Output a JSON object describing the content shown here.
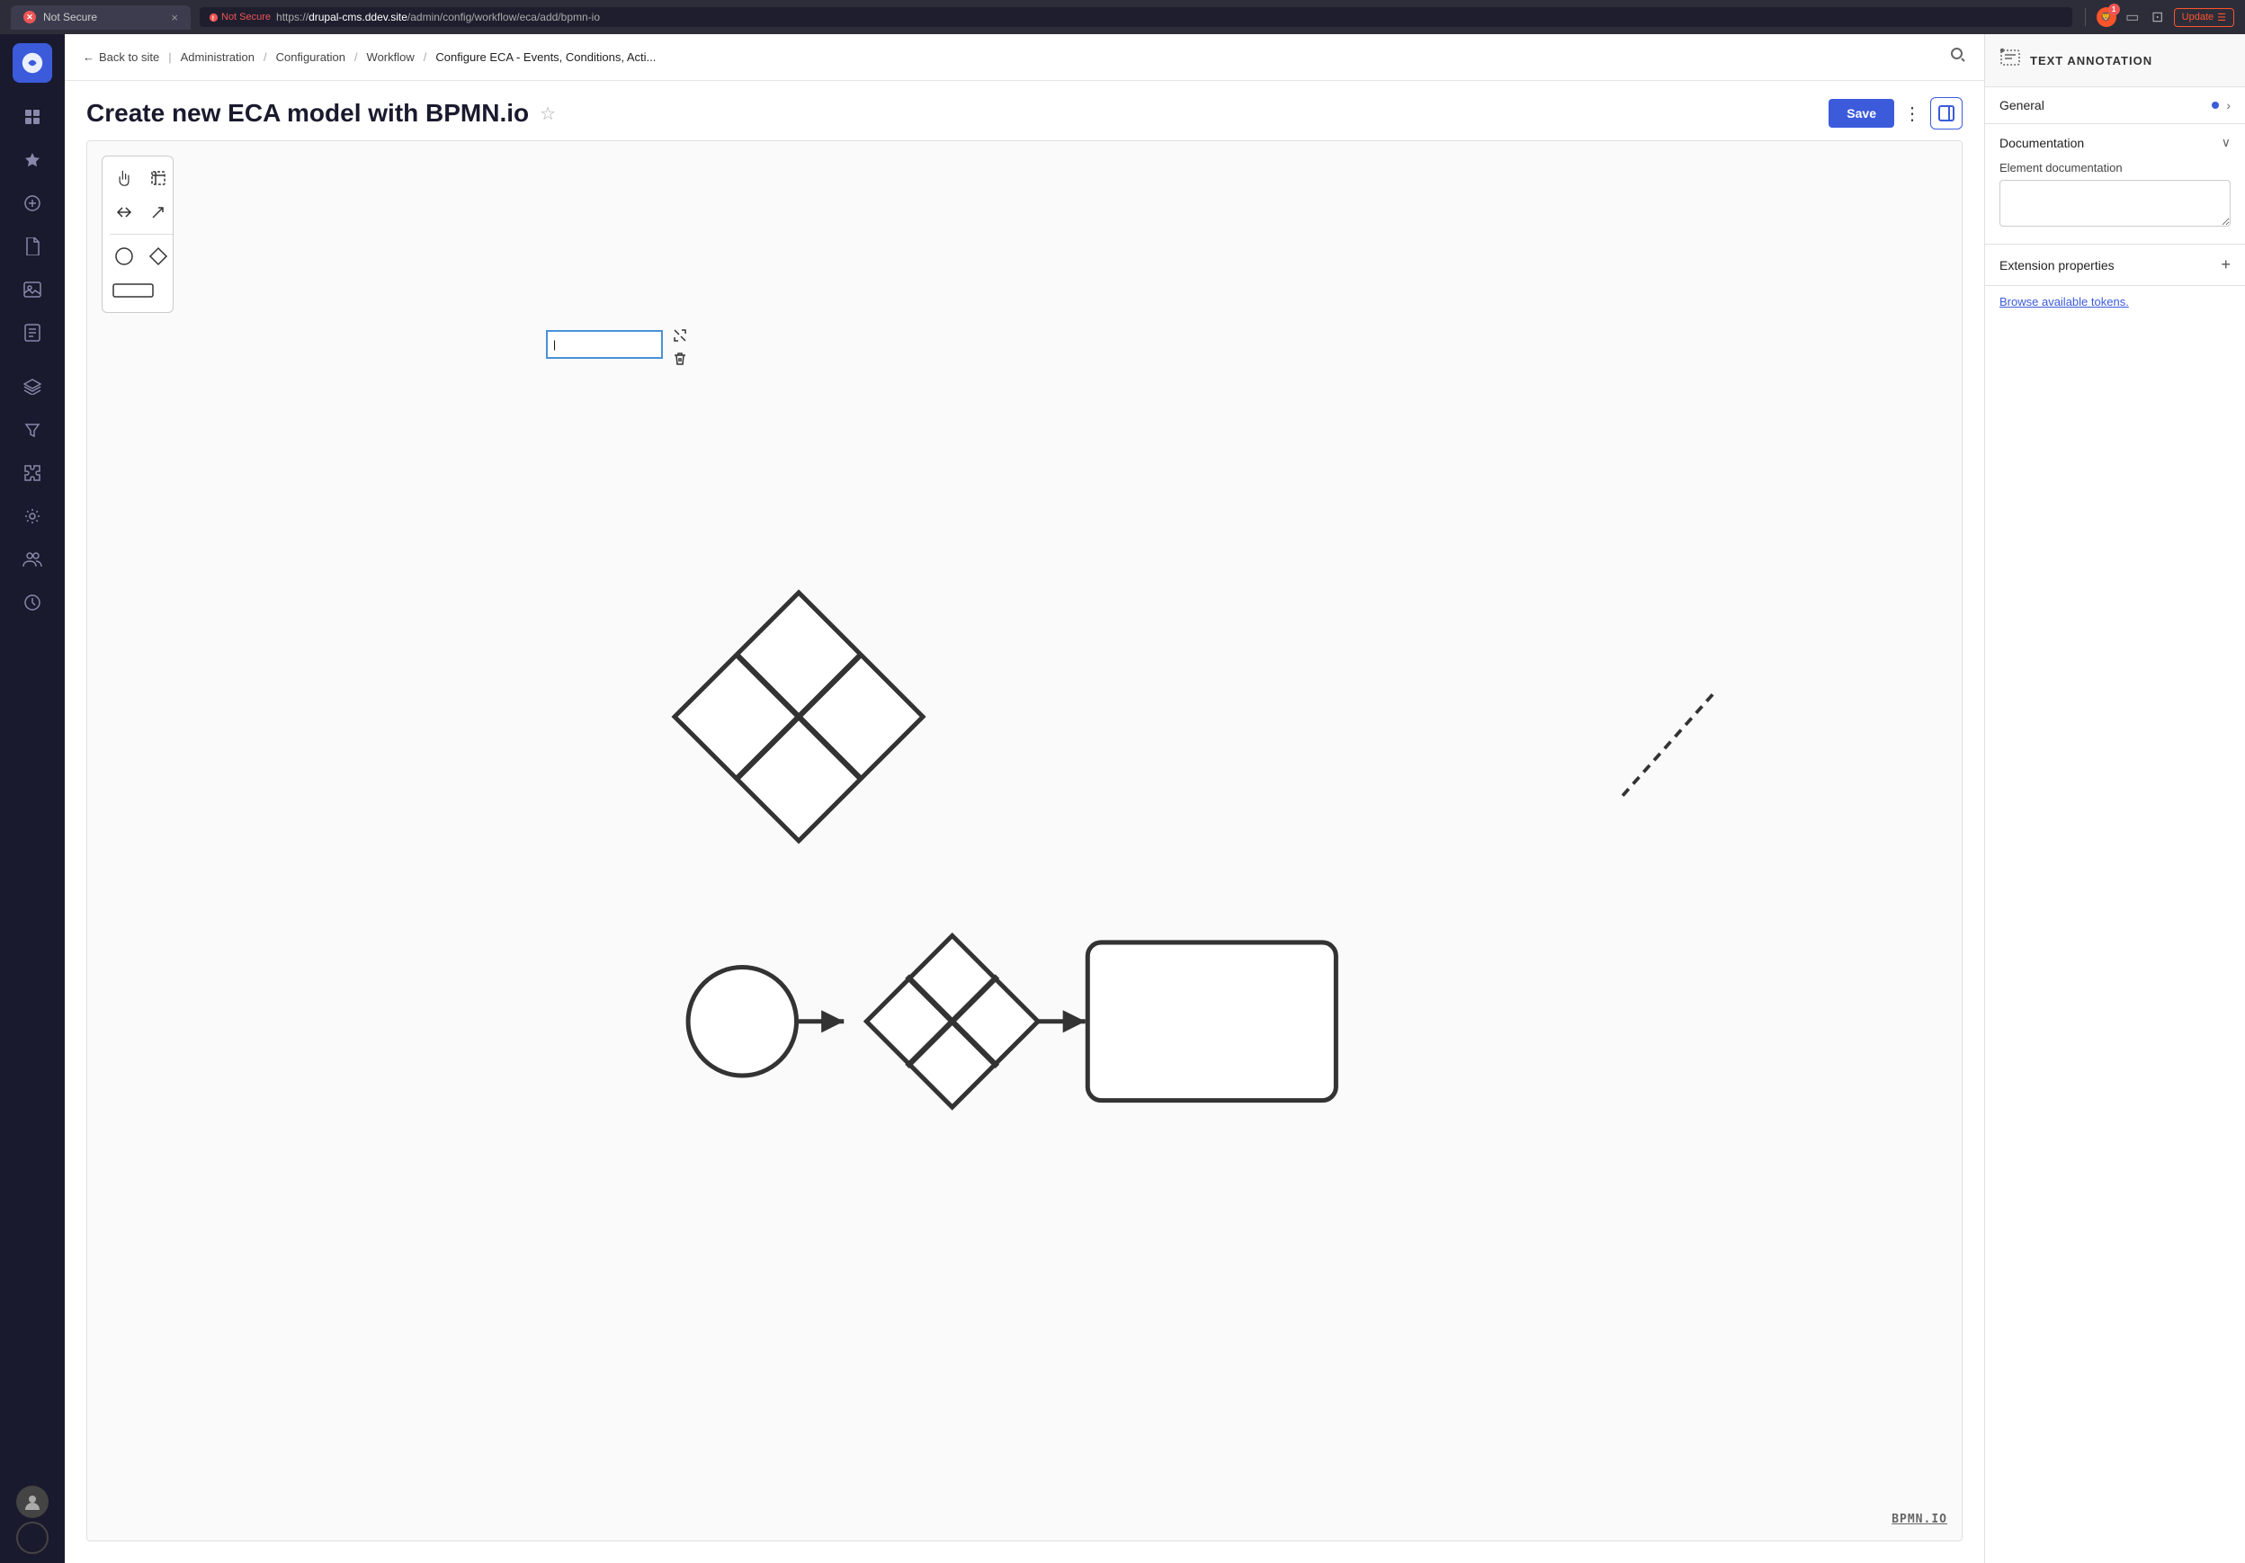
{
  "browser": {
    "tab_title": "Not Secure",
    "tab_favicon_label": "✕",
    "url_prefix": "https://",
    "url_domain": "drupal-cms.ddev.site",
    "url_path": "/admin/config/workflow/eca/add/bpmn-io",
    "brave_badge": "1",
    "update_button": "Update"
  },
  "breadcrumbs": {
    "back_label": "Back to site",
    "items": [
      {
        "label": "Administration"
      },
      {
        "label": "Configuration"
      },
      {
        "label": "Workflow"
      },
      {
        "label": "Configure ECA - Events, Conditions, Acti..."
      }
    ],
    "separator": "/"
  },
  "page": {
    "title": "Create new ECA model with BPMN.io",
    "save_button": "Save",
    "panel_toggle_title": "Toggle panel"
  },
  "right_panel": {
    "header_icon": "···",
    "title": "TEXT ANNOTATION",
    "sections": [
      {
        "label": "General",
        "has_dot": true,
        "has_chevron": true
      }
    ],
    "documentation": {
      "label": "Documentation",
      "element_doc_label": "Element documentation",
      "textarea_placeholder": ""
    },
    "extension": {
      "label": "Extension properties",
      "add_icon": "+"
    },
    "browse_tokens": "Browse available tokens."
  },
  "sidebar": {
    "items": [
      {
        "name": "dashboard",
        "icon": "⊞",
        "active": false
      },
      {
        "name": "starred",
        "icon": "☆",
        "active": false
      },
      {
        "name": "add",
        "icon": "⊕",
        "active": false
      },
      {
        "name": "document",
        "icon": "⊡",
        "active": false
      },
      {
        "name": "media",
        "icon": "⊟",
        "active": false
      },
      {
        "name": "page",
        "icon": "□",
        "active": false
      },
      {
        "name": "layers",
        "icon": "⧉",
        "active": false
      },
      {
        "name": "filter",
        "icon": "⊽",
        "active": false
      },
      {
        "name": "puzzle",
        "icon": "⌘",
        "active": false
      },
      {
        "name": "settings",
        "icon": "⚙",
        "active": false
      },
      {
        "name": "users",
        "icon": "👥",
        "active": false
      },
      {
        "name": "clock",
        "icon": "⏱",
        "active": false
      }
    ]
  },
  "bpmn": {
    "watermark": "BPMN.IO"
  },
  "toolbar": {
    "tools": [
      {
        "name": "hand",
        "icon": "✋"
      },
      {
        "name": "select",
        "icon": "⊹"
      },
      {
        "name": "resize",
        "icon": "↔"
      },
      {
        "name": "arrow",
        "icon": "↗"
      }
    ],
    "shapes": [
      {
        "name": "circle"
      },
      {
        "name": "diamond"
      },
      {
        "name": "rectangle"
      }
    ]
  }
}
